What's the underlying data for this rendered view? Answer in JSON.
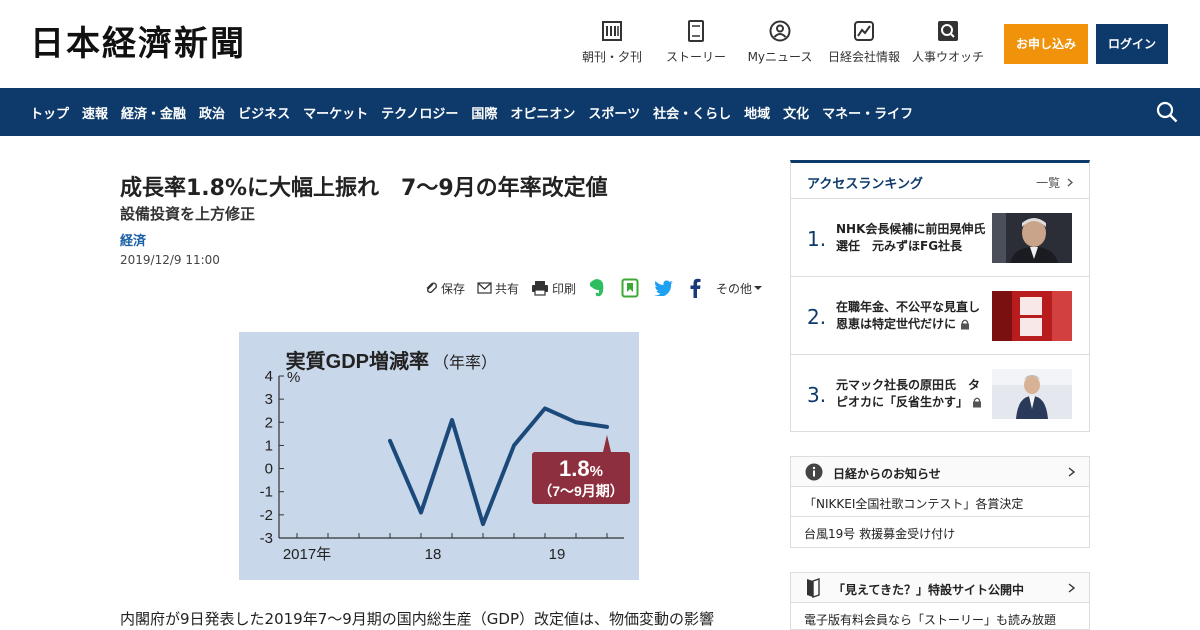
{
  "header": {
    "logo": "日本経濟新聞",
    "nav": [
      {
        "label": "朝刊・夕刊",
        "icon": "newspaper-icon"
      },
      {
        "label": "ストーリー",
        "icon": "book-icon"
      },
      {
        "label": "Myニュース",
        "icon": "user-icon"
      },
      {
        "label": "日経会社情報",
        "icon": "chart-icon"
      },
      {
        "label": "人事ウオッチ",
        "icon": "search-icon"
      }
    ],
    "apply_label": "お申し込み",
    "login_label": "ログイン"
  },
  "categories": [
    "トップ",
    "速報",
    "経済・金融",
    "政治",
    "ビジネス",
    "マーケット",
    "テクノロジー",
    "国際",
    "オピニオン",
    "スポーツ",
    "社会・くらし",
    "地域",
    "文化",
    "マネー・ライフ"
  ],
  "article": {
    "headline": "成長率1.8%に大幅上振れ　7～9月の年率改定値",
    "subheadline": "設備投資を上方修正",
    "category": "経済",
    "date": "2019/12/9 11:00",
    "tools": {
      "save": "保存",
      "share": "共有",
      "print": "印刷",
      "more": "その他"
    },
    "body_start": "内閣府が9日発表した2019年7～9月期の国内総生産（GDP）改定値は、物価変動の影響"
  },
  "chart_data": {
    "type": "line",
    "title": "実質GDP増減率",
    "title_suffix": "（年率）",
    "ylabel": "%",
    "ylim": [
      -3,
      4
    ],
    "yticks": [
      "4",
      "3",
      "2",
      "1",
      "0",
      "-1",
      "-2",
      "-3"
    ],
    "xtick_labels": [
      "2017年",
      "18",
      "19"
    ],
    "x": [
      "2017-Q1",
      "2017-Q2",
      "2017-Q3",
      "2017-Q4",
      "2018-Q1",
      "2018-Q2",
      "2018-Q3",
      "2018-Q4",
      "2019-Q1",
      "2019-Q2",
      "2019-Q3"
    ],
    "series": [
      {
        "values": [
          1.2,
          -1.9,
          2.1,
          -2.4,
          1.0,
          2.6,
          2.0,
          1.8
        ]
      }
    ],
    "annotation": {
      "value": "1.8",
      "unit": "%",
      "label": "（7～9月期）"
    },
    "line_color": "#1b4a7a",
    "background_color": "#c9d7ea",
    "callout_color": "#8e2f3f"
  },
  "sidebar": {
    "ranking": {
      "title": "アクセスランキング",
      "more": "一覧",
      "items": [
        {
          "num": "1.",
          "text": "NHK会長候補に前田晃伸氏選任　元みずほFG社長",
          "locked": false
        },
        {
          "num": "2.",
          "text": "在職年金、不公平な見直し　恩恵は特定世代だけに",
          "locked": true
        },
        {
          "num": "3.",
          "text": "元マック社長の原田氏　タピオカに「反省生かす」",
          "locked": true
        }
      ]
    },
    "notice": {
      "title": "日経からのお知らせ",
      "items": [
        "「NIKKEI全国社歌コンテスト」各賞決定",
        "台風19号 救援募金受け付け"
      ]
    },
    "special": {
      "title": "「見えてきた？」特設サイト公開中",
      "text": "電子版有料会員なら「ストーリー」も読み放題"
    }
  }
}
